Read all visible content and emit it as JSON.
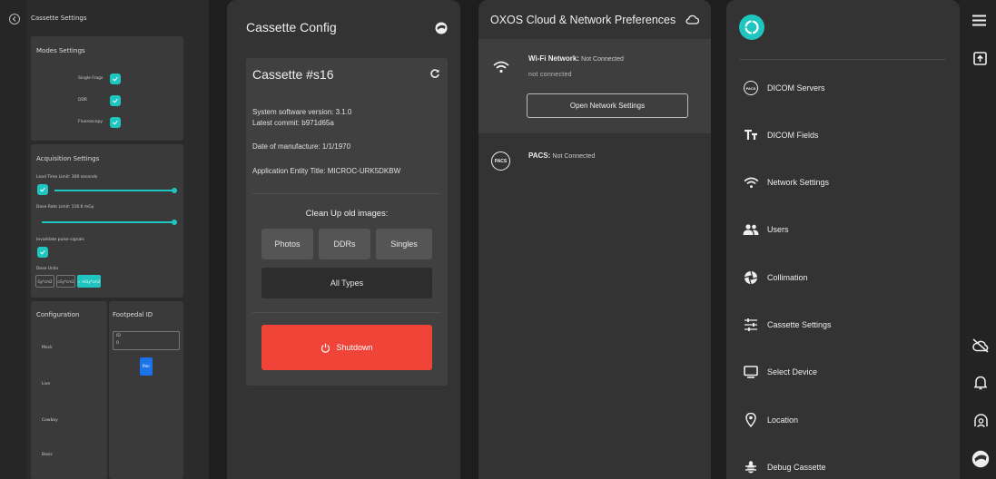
{
  "cassette_settings": {
    "title": "Cassette Settings",
    "modes": {
      "heading": "Modes Settings",
      "items": [
        {
          "label": "Single Frags"
        },
        {
          "label": "DDR"
        },
        {
          "label": "Fluoroscopy"
        }
      ]
    },
    "acquisition": {
      "heading": "Acquisition Settings",
      "load_time_label": "Load Time Limit: 300 seconds",
      "dose_rate_label": "Dose Rate Limit: 116.6 mGy",
      "invalidate_label": "Invalidate pulse signals",
      "dose_units_label": "Dose Units",
      "dose_units": [
        "Gy*cm2",
        "cGy*cm2",
        "mGy*cm2"
      ],
      "dose_units_active": 2
    },
    "configuration": {
      "heading": "Configuration",
      "items": [
        "Mock",
        "Live",
        "Cowboy",
        "Basic"
      ]
    },
    "footpedal": {
      "heading": "Footpedal ID",
      "field_label": "ID",
      "field_value": "0",
      "pair_label": "Pair"
    }
  },
  "cassette_config": {
    "title": "Cassette Config",
    "cassette_name": "Cassette #s16",
    "software_version": "System software version: 3.1.0",
    "latest_commit": "Latest commit: b971d65a",
    "manufacture_date": "Date of manufacture: 1/1/1970",
    "ae_title": "Application Entity Title: MICROC-URK5DKBW",
    "cleanup_heading": "Clean Up old images:",
    "cleanup_buttons": [
      "Photos",
      "DDRs",
      "Singles"
    ],
    "all_types_label": "All Types",
    "shutdown_label": "Shutdown"
  },
  "cloud_prefs": {
    "title": "OXOS Cloud & Network Preferences",
    "wifi_label": "Wi-Fi Network:",
    "wifi_status": "Not Connected",
    "wifi_sub": "not connected",
    "open_network_label": "Open Network Settings",
    "pacs_label": "PACS:",
    "pacs_status": "Not Connected",
    "pacs_icon_text": "PACS"
  },
  "menu": {
    "pacs_icon_text": "PACS",
    "items": [
      {
        "label": "DICOM Servers",
        "icon": "pacs-icon"
      },
      {
        "label": "DICOM Fields",
        "icon": "text-fields-icon"
      },
      {
        "label": "Network Settings",
        "icon": "wifi-icon"
      },
      {
        "label": "Users",
        "icon": "users-icon"
      },
      {
        "label": "Collimation",
        "icon": "aperture-icon"
      },
      {
        "label": "Cassette Settings",
        "icon": "tune-icon"
      },
      {
        "label": "Select Device",
        "icon": "monitor-icon"
      },
      {
        "label": "Location",
        "icon": "location-pin-icon"
      },
      {
        "label": "Debug Cassette",
        "icon": "bug-icon"
      }
    ]
  },
  "colors": {
    "accent": "#1fc6c0",
    "shutdown": "#f04438",
    "pair_button": "#1a73e8"
  }
}
